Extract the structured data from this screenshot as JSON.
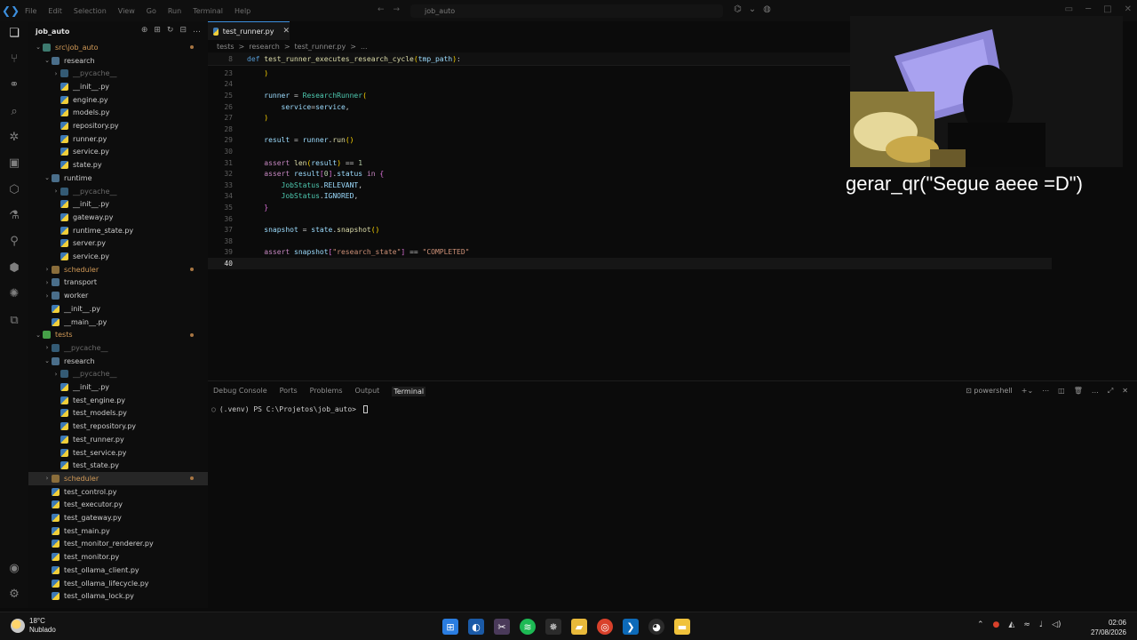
{
  "titlebar": {
    "menu": [
      "File",
      "Edit",
      "Selection",
      "View",
      "Go",
      "Run",
      "Terminal",
      "Help"
    ],
    "search": "job_auto"
  },
  "explorer": {
    "title": "job_auto",
    "tree": [
      {
        "label": "src\\job_auto",
        "depth": 1,
        "kind": "folder-src",
        "chev": "open",
        "cls": "orange",
        "dot": true
      },
      {
        "label": "research",
        "depth": 2,
        "kind": "folder",
        "chev": "open"
      },
      {
        "label": "__pycache__",
        "depth": 3,
        "kind": "folder-cache",
        "chev": "closed",
        "cls": "dim"
      },
      {
        "label": "__init__.py",
        "depth": 3,
        "kind": "py"
      },
      {
        "label": "engine.py",
        "depth": 3,
        "kind": "py"
      },
      {
        "label": "models.py",
        "depth": 3,
        "kind": "py"
      },
      {
        "label": "repository.py",
        "depth": 3,
        "kind": "py"
      },
      {
        "label": "runner.py",
        "depth": 3,
        "kind": "py"
      },
      {
        "label": "service.py",
        "depth": 3,
        "kind": "py"
      },
      {
        "label": "state.py",
        "depth": 3,
        "kind": "py"
      },
      {
        "label": "runtime",
        "depth": 2,
        "kind": "folder",
        "chev": "open"
      },
      {
        "label": "__pycache__",
        "depth": 3,
        "kind": "folder-cache",
        "chev": "closed",
        "cls": "dim"
      },
      {
        "label": "__init__.py",
        "depth": 3,
        "kind": "py"
      },
      {
        "label": "gateway.py",
        "depth": 3,
        "kind": "py"
      },
      {
        "label": "runtime_state.py",
        "depth": 3,
        "kind": "py"
      },
      {
        "label": "server.py",
        "depth": 3,
        "kind": "py"
      },
      {
        "label": "service.py",
        "depth": 3,
        "kind": "py"
      },
      {
        "label": "scheduler",
        "depth": 2,
        "kind": "folder-sched",
        "chev": "closed",
        "cls": "orange",
        "dot": true
      },
      {
        "label": "transport",
        "depth": 2,
        "kind": "folder",
        "chev": "closed"
      },
      {
        "label": "worker",
        "depth": 2,
        "kind": "folder",
        "chev": "closed"
      },
      {
        "label": "__init__.py",
        "depth": 2,
        "kind": "py"
      },
      {
        "label": "__main__.py",
        "depth": 2,
        "kind": "py"
      },
      {
        "label": "tests",
        "depth": 1,
        "kind": "folder-tests",
        "chev": "open",
        "cls": "orange",
        "dot": true
      },
      {
        "label": "__pycache__",
        "depth": 2,
        "kind": "folder-cache",
        "chev": "closed",
        "cls": "dim"
      },
      {
        "label": "research",
        "depth": 2,
        "kind": "folder",
        "chev": "open"
      },
      {
        "label": "__pycache__",
        "depth": 3,
        "kind": "folder-cache",
        "chev": "closed",
        "cls": "dim"
      },
      {
        "label": "__init__.py",
        "depth": 3,
        "kind": "py"
      },
      {
        "label": "test_engine.py",
        "depth": 3,
        "kind": "py"
      },
      {
        "label": "test_models.py",
        "depth": 3,
        "kind": "py"
      },
      {
        "label": "test_repository.py",
        "depth": 3,
        "kind": "py"
      },
      {
        "label": "test_runner.py",
        "depth": 3,
        "kind": "py"
      },
      {
        "label": "test_service.py",
        "depth": 3,
        "kind": "py"
      },
      {
        "label": "test_state.py",
        "depth": 3,
        "kind": "py"
      },
      {
        "label": "scheduler",
        "depth": 2,
        "kind": "folder-sched",
        "chev": "closed",
        "cls": "orange",
        "dot": true,
        "selected": true
      },
      {
        "label": "test_control.py",
        "depth": 2,
        "kind": "py"
      },
      {
        "label": "test_executor.py",
        "depth": 2,
        "kind": "py"
      },
      {
        "label": "test_gateway.py",
        "depth": 2,
        "kind": "py"
      },
      {
        "label": "test_main.py",
        "depth": 2,
        "kind": "py"
      },
      {
        "label": "test_monitor_renderer.py",
        "depth": 2,
        "kind": "py"
      },
      {
        "label": "test_monitor.py",
        "depth": 2,
        "kind": "py"
      },
      {
        "label": "test_ollama_client.py",
        "depth": 2,
        "kind": "py"
      },
      {
        "label": "test_ollama_lifecycle.py",
        "depth": 2,
        "kind": "py"
      },
      {
        "label": "test_ollama_lock.py",
        "depth": 2,
        "kind": "py"
      }
    ]
  },
  "editor": {
    "tab": "test_runner.py",
    "breadcrumb": [
      "tests",
      ">",
      "research",
      ">",
      "test_runner.py",
      ">",
      "..."
    ],
    "sticky": {
      "line": "8",
      "code": "def test_runner_executes_research_cycle(tmp_path):"
    },
    "lines": [
      {
        "n": "23",
        "code": "    )"
      },
      {
        "n": "24",
        "code": ""
      },
      {
        "n": "25",
        "code": "    runner = ResearchRunner("
      },
      {
        "n": "26",
        "code": "        service=service,"
      },
      {
        "n": "27",
        "code": "    )"
      },
      {
        "n": "28",
        "code": ""
      },
      {
        "n": "29",
        "code": "    result = runner.run()"
      },
      {
        "n": "30",
        "code": ""
      },
      {
        "n": "31",
        "code": "    assert len(result) == 1"
      },
      {
        "n": "32",
        "code": "    assert result[0].status in {"
      },
      {
        "n": "33",
        "code": "        JobStatus.RELEVANT,"
      },
      {
        "n": "34",
        "code": "        JobStatus.IGNORED,"
      },
      {
        "n": "35",
        "code": "    }"
      },
      {
        "n": "36",
        "code": ""
      },
      {
        "n": "37",
        "code": "    snapshot = state.snapshot()"
      },
      {
        "n": "38",
        "code": ""
      },
      {
        "n": "39",
        "code": "    assert snapshot[\"research_state\"] == \"COMPLETED\""
      },
      {
        "n": "40",
        "code": "",
        "current": true
      }
    ]
  },
  "panel": {
    "tabs": [
      "Debug Console",
      "Ports",
      "Problems",
      "Output",
      "Terminal"
    ],
    "active_tab": "Terminal",
    "shell": "powershell",
    "prompt": "(.venv) PS C:\\Projetos\\job_auto> "
  },
  "overlay": {
    "caption": "gerar_qr(\"Segue aeee =D\")"
  },
  "taskbar": {
    "temp": "18°C",
    "condition": "Nublado",
    "time": "02:06",
    "date": "27/08/2026"
  }
}
